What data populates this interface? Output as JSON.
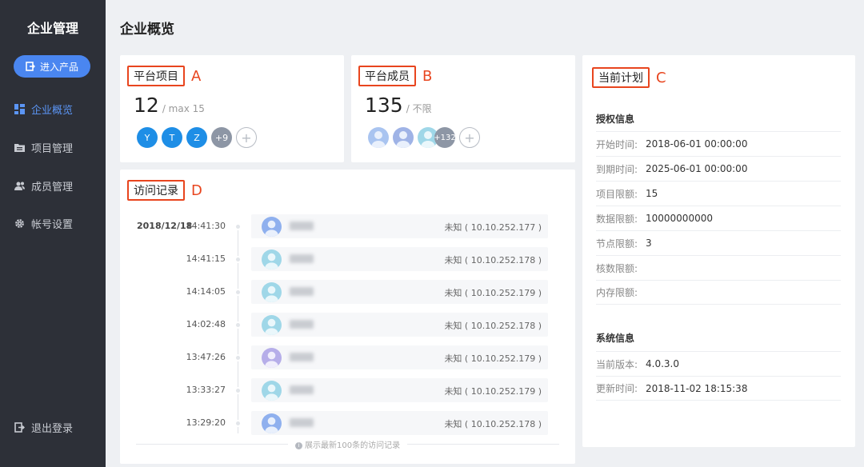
{
  "sidebar": {
    "title": "企业管理",
    "enter_button": "进入产品",
    "items": [
      {
        "label": "企业概览",
        "icon": "dashboard-icon"
      },
      {
        "label": "项目管理",
        "icon": "folder-icon"
      },
      {
        "label": "成员管理",
        "icon": "users-icon"
      },
      {
        "label": "帐号设置",
        "icon": "gear-icon"
      }
    ],
    "logout": "退出登录"
  },
  "page": {
    "title": "企业概览"
  },
  "projects_card": {
    "title": "平台项目",
    "marker": "A",
    "count": "12",
    "limit": "/ max 15",
    "avatars": [
      "Y",
      "T",
      "Z",
      "+9"
    ]
  },
  "members_card": {
    "title": "平台成员",
    "marker": "B",
    "count": "135",
    "limit": "/ 不限",
    "more": "+132"
  },
  "plan_card": {
    "title": "当前计划",
    "marker": "C",
    "license_section": "授权信息",
    "license": [
      {
        "k": "开始时间:",
        "v": "2018-06-01 00:00:00"
      },
      {
        "k": "到期时间:",
        "v": "2025-06-01 00:00:00"
      },
      {
        "k": "项目限额:",
        "v": "15"
      },
      {
        "k": "数据限额:",
        "v": "10000000000"
      },
      {
        "k": "节点限额:",
        "v": "3"
      },
      {
        "k": "核数限额:",
        "v": ""
      },
      {
        "k": "内存限额:",
        "v": ""
      }
    ],
    "system_section": "系统信息",
    "system": [
      {
        "k": "当前版本:",
        "v": "4.0.3.0"
      },
      {
        "k": "更新时间:",
        "v": "2018-11-02 18:15:38"
      }
    ]
  },
  "visits_card": {
    "title": "访问记录",
    "marker": "D",
    "date": "2018/12/18",
    "rows": [
      {
        "time": "14:41:30",
        "loc": "未知 ( 10.10.252.177 )"
      },
      {
        "time": "14:41:15",
        "loc": "未知 ( 10.10.252.178 )"
      },
      {
        "time": "14:14:05",
        "loc": "未知 ( 10.10.252.179 )"
      },
      {
        "time": "14:02:48",
        "loc": "未知 ( 10.10.252.178 )"
      },
      {
        "time": "13:47:26",
        "loc": "未知 ( 10.10.252.179 )"
      },
      {
        "time": "13:33:27",
        "loc": "未知 ( 10.10.252.179 )"
      },
      {
        "time": "13:29:20",
        "loc": "未知 ( 10.10.252.178 )"
      }
    ],
    "footer": "展示最新100条的访问记录"
  },
  "colors": {
    "sidebar_bg": "#2d3038",
    "accent": "#4a86f0",
    "highlight": "#e8451e"
  }
}
